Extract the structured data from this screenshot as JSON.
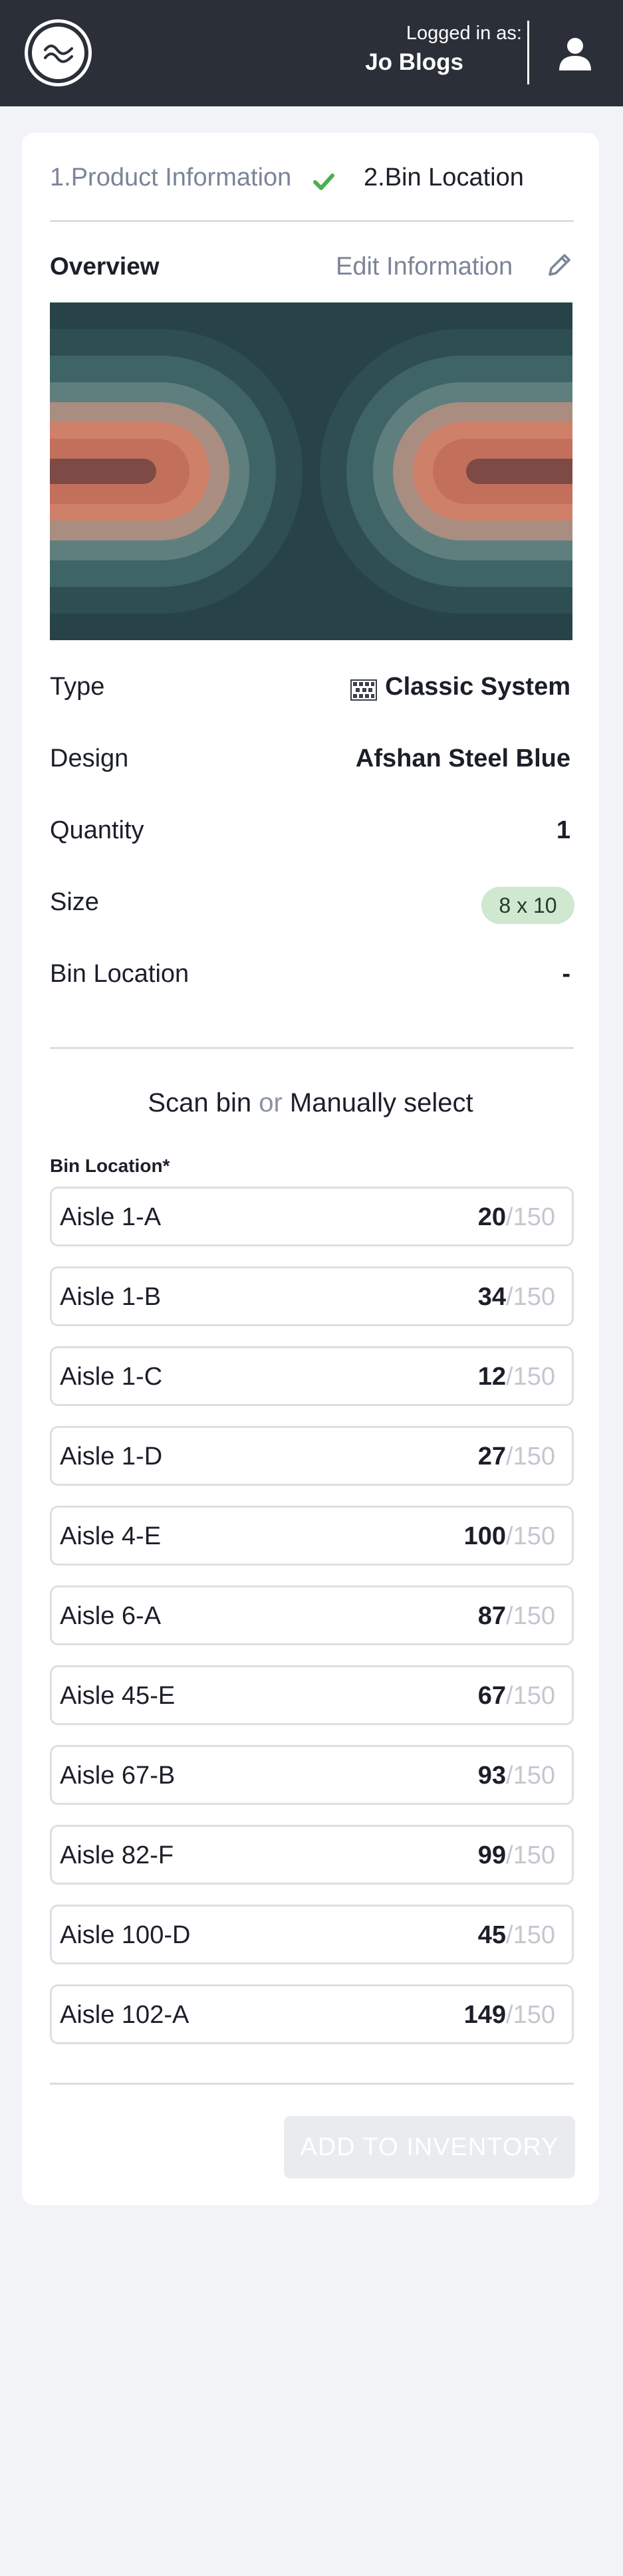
{
  "header": {
    "logged_in_label": "Logged in as:",
    "user_name": "Jo Blogs"
  },
  "steps": {
    "step1_label": "1.Product Information",
    "step2_label": "2.Bin Location"
  },
  "overview": {
    "title": "Overview",
    "edit_label": "Edit Information"
  },
  "details": {
    "type_label": "Type",
    "type_value": "Classic System",
    "design_label": "Design",
    "design_value": "Afshan Steel Blue",
    "quantity_label": "Quantity",
    "quantity_value": "1",
    "size_label": "Size",
    "size_value": "8 x 10",
    "bin_location_label": "Bin Location",
    "bin_location_value": "-"
  },
  "bin_select": {
    "scan_label": "Scan bin",
    "or_label": "or",
    "manual_label": "Manually select",
    "field_label": "Bin Location*",
    "capacity_suffix": "/150",
    "bins": [
      {
        "name": "Aisle 1-A",
        "count": "20"
      },
      {
        "name": "Aisle 1-B",
        "count": "34"
      },
      {
        "name": "Aisle 1-C",
        "count": "12"
      },
      {
        "name": "Aisle 1-D",
        "count": "27"
      },
      {
        "name": "Aisle 4-E",
        "count": "100"
      },
      {
        "name": "Aisle 6-A",
        "count": "87"
      },
      {
        "name": "Aisle 45-E",
        "count": "67"
      },
      {
        "name": "Aisle 67-B",
        "count": "93"
      },
      {
        "name": "Aisle 82-F",
        "count": "99"
      },
      {
        "name": "Aisle 100-D",
        "count": "45"
      },
      {
        "name": "Aisle 102-A",
        "count": "149"
      }
    ]
  },
  "actions": {
    "add_label": "ADD TO INVENTORY"
  },
  "colors": {
    "header_bg": "#2b2f38",
    "page_bg": "#f2f3f7",
    "check_green": "#4caf50",
    "muted_text": "#7b8598",
    "size_badge_bg": "#cfe8cf",
    "disabled_button_bg": "#e9ebef"
  }
}
